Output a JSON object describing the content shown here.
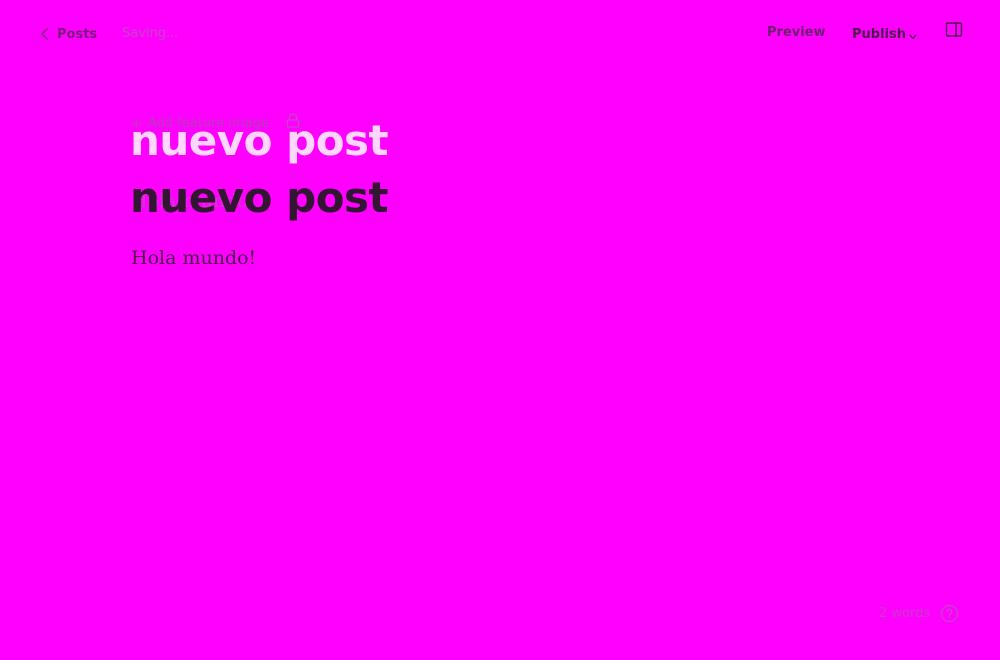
{
  "header": {
    "back_label": "Posts",
    "status": "Saving...",
    "preview_label": "Preview",
    "publish_label": "Publish"
  },
  "editor": {
    "feature_image_label": "Add feature image",
    "title_ghost": "nuevo post",
    "title": "nuevo post",
    "body_ghost": "Hola mundo!",
    "body": "Hola mundo!"
  },
  "footer": {
    "word_count": "2 words"
  },
  "icons": {
    "back": "chevron-left-icon",
    "publish_caret": "chevron-down-icon",
    "settings": "sidebar-panel-icon",
    "feature_image": "plus-icon",
    "lock": "lock-icon",
    "help": "question-circle-icon"
  },
  "colors": {
    "background": "#ff00ff",
    "title": "#311531",
    "title_ghost": "#ffd6ff"
  }
}
